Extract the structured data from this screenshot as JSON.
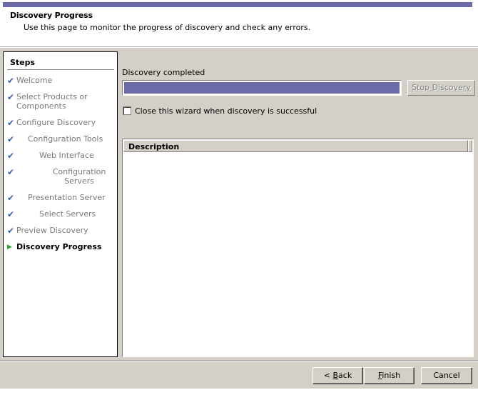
{
  "header": {
    "title": "Discovery Progress",
    "subtitle": "Use this page to monitor the progress of discovery and check any errors."
  },
  "steps": {
    "title": "Steps",
    "items": [
      {
        "label": "Welcome",
        "state": "done"
      },
      {
        "label": "Select Products or Components",
        "state": "done"
      },
      {
        "label": "Configure Discovery",
        "state": "done"
      },
      {
        "label": "Configuration Tools",
        "state": "done"
      },
      {
        "label": "Web Interface",
        "state": "done"
      },
      {
        "label": "Configuration Servers",
        "state": "done"
      },
      {
        "label": "Presentation Server",
        "state": "done"
      },
      {
        "label": "Select Servers",
        "state": "done"
      },
      {
        "label": "Preview Discovery",
        "state": "done"
      },
      {
        "label": "Discovery Progress",
        "state": "current"
      }
    ]
  },
  "progress": {
    "label": "Discovery completed",
    "percent": 100,
    "stop_label": "Stop Discovery"
  },
  "close_option": {
    "label": "Close this wizard when discovery is successful",
    "checked": false
  },
  "description": {
    "column_header": "Description",
    "rows": []
  },
  "footer": {
    "back_label": "Back",
    "back_label_mnemonic": "B",
    "back_label_rest": "ack",
    "finish_label": "Finish",
    "finish_label_mnemonic": "F",
    "finish_label_rest": "inish",
    "cancel_label": "Cancel"
  },
  "colors": {
    "accent": "#6b6ba8",
    "check": "#3a5ea8",
    "current_arrow": "#2ea02e",
    "dialog_bg": "#d4d0c8"
  }
}
